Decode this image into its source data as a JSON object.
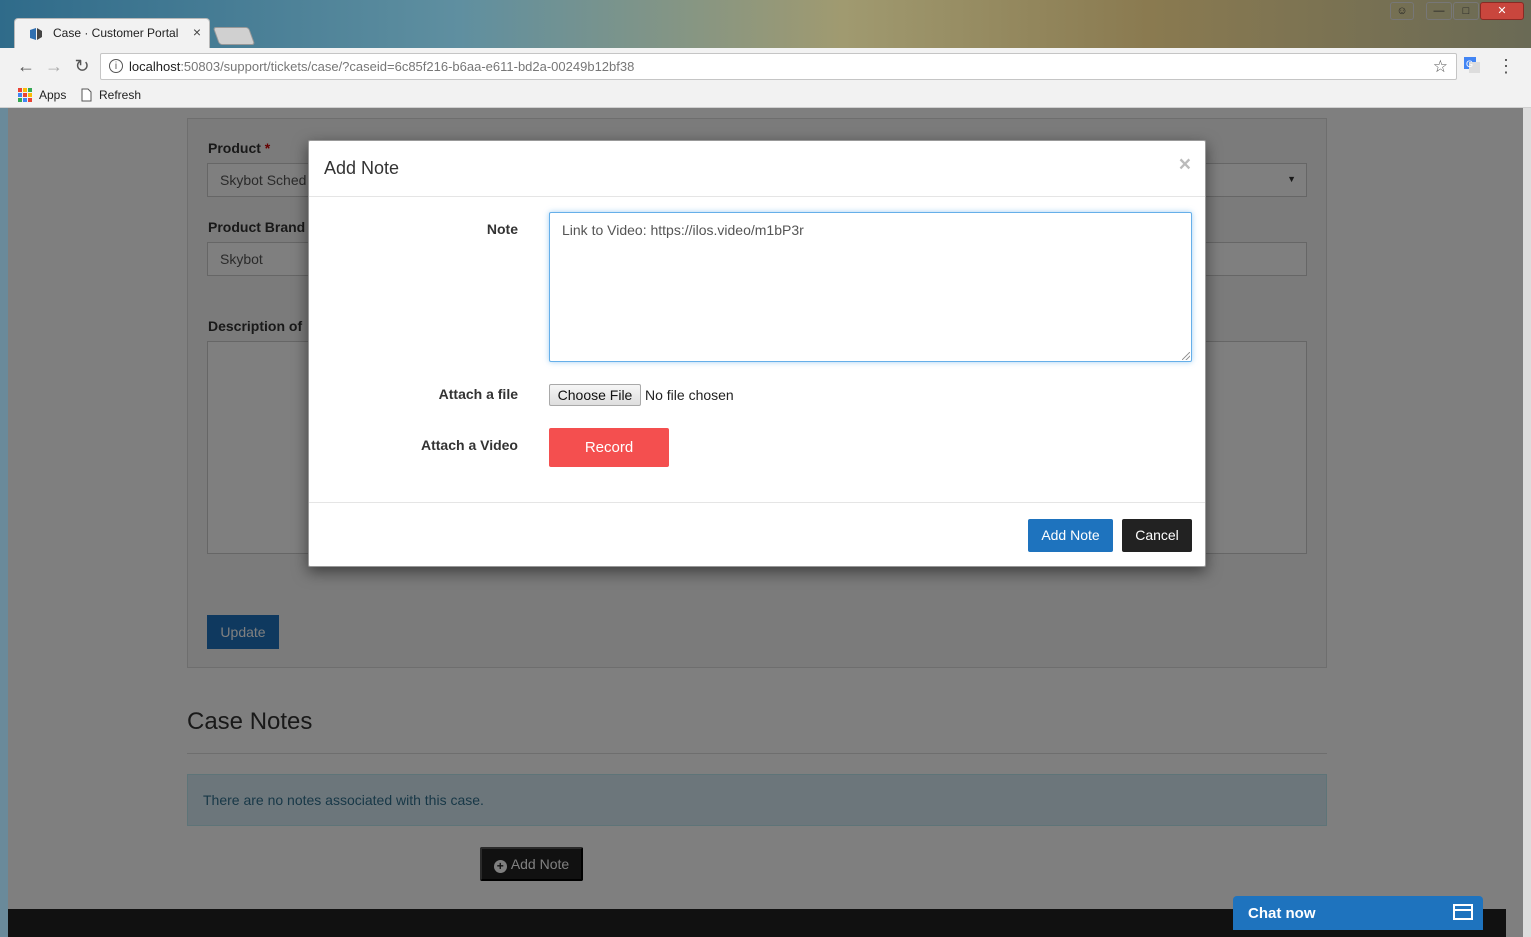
{
  "browser": {
    "tab_title": "Case · Customer Portal",
    "tab_close": "×",
    "url_host": "localhost",
    "url_path": ":50803/support/tickets/case/?caseid=6c85f216-b6aa-e611-bd2a-00249b12bf38",
    "bookmarks": {
      "apps": "Apps",
      "refresh": "Refresh"
    },
    "back_icon": "←",
    "forward_icon": "→",
    "reload_icon": "↻",
    "star_icon": "☆",
    "menu_icon": "⋮",
    "info_icon": "i"
  },
  "form": {
    "product_label": "Product",
    "required_mark": "*",
    "product_value": "Skybot Sched",
    "brand_label": "Product Brand",
    "brand_value": "Skybot",
    "description_label": "Description of",
    "update_button": "Update"
  },
  "case_notes": {
    "heading": "Case Notes",
    "empty_message": "There are no notes associated with this case.",
    "add_note_button": "Add Note",
    "add_icon": "+"
  },
  "chat": {
    "label": "Chat now"
  },
  "modal": {
    "title": "Add Note",
    "close": "×",
    "note_label": "Note",
    "note_value": "Link to Video: https://ilos.video/m1bP3r",
    "attach_file_label": "Attach a file",
    "choose_file_button": "Choose File",
    "no_file_text": "No file chosen",
    "attach_video_label": "Attach a Video",
    "record_button": "Record",
    "add_note_button": "Add Note",
    "cancel_button": "Cancel"
  },
  "colors": {
    "primary": "#1e73be",
    "record": "#f44f4f",
    "dark": "#222222",
    "alert_bg": "#d9edf7"
  }
}
